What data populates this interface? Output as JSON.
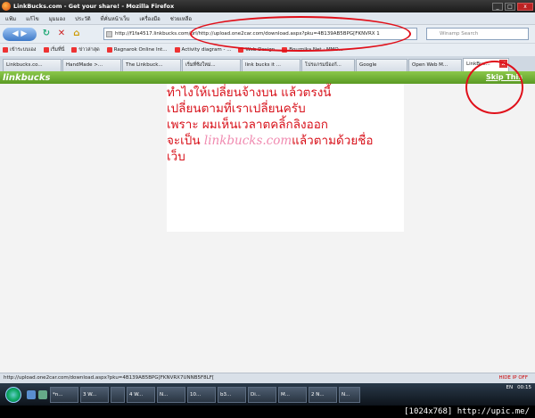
{
  "window": {
    "title": "LinkBucks.com - Get your share! - Mozilla Firefox",
    "min": "_",
    "max": "□",
    "close": "x"
  },
  "menubar": [
    "แฟ้ม",
    "แก้ไข",
    "มุมมอง",
    "ประวัติ",
    "ที่คั่นหน้าเว็บ",
    "เครื่องมือ",
    "ช่วยเหลือ"
  ],
  "navbar": {
    "url": "http://f1fa4517.linkbucks.com/url/http://upload.one2car.com/download.aspx?pku=4B139AB5BPG[FKNVRX 1",
    "search_placeholder": "Winamp Search"
  },
  "bookmarks": [
    "เข้าระบบเอง",
    "เริ่มที่นี่",
    "ข่าวล่าสุด",
    "Ragnarok Online Int...",
    "Activity diagram - ...",
    "",
    "Web Design",
    "Bouznika Net : MMO..."
  ],
  "tabs": [
    "Linkbucks.co...",
    "HandMade >...",
    "The Linkbuck...",
    "เริ่มที่ซิงใหม่...",
    "link bucks it ...",
    "โปรแกรมป้องกั...",
    "Google",
    "Open Web M...",
    "LinkBuc..."
  ],
  "linkbucks": {
    "logo": "linkbucks",
    "skip": "Skip This"
  },
  "annotation": {
    "line1": "ทำไงให้เปลี่ยนจ้างบน แล้วตรงนี้",
    "line2": "เปลี่ยนตามที่เราเปลี่ยนครับ",
    "line3": "เพราะ ผมเห็นเวลาตคลิ้กลิงออก",
    "line4_pre": "จะเป็น ",
    "line4_brand": "linkbucks.com",
    "line4_post": "แล้วตามด้วยชื่อ",
    "line5": "เว็บ"
  },
  "status": {
    "text": "http://upload.one2car.com/download.aspx?pku=4B139AB5BPG[FKNVRX7UNNB5F8LF[",
    "hide": "HIDE IP OFF"
  },
  "taskbar": {
    "items": [
      "*n...",
      "3 W...",
      "",
      "4 W...",
      "N...",
      "10...",
      "b3...",
      "Di...",
      "M...",
      "2 N...",
      "N..."
    ],
    "lang": "EN",
    "time": "00:15"
  },
  "caption": "[1024x768] http://upic.me/",
  "colors": {
    "accent": "#d8121b",
    "linkbucks_green": "#6fae33",
    "brand_pink": "#f08ab0"
  }
}
